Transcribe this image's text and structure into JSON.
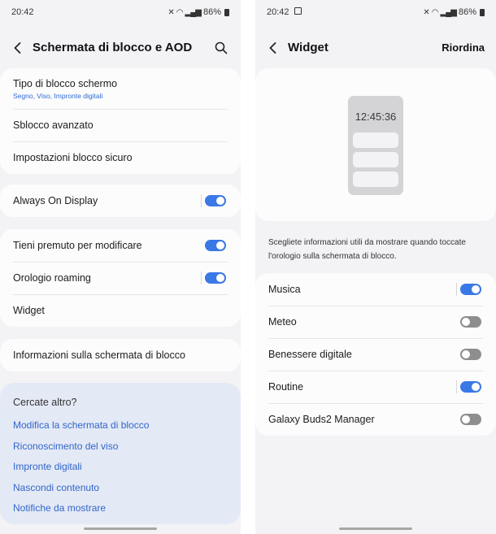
{
  "left": {
    "status": {
      "time": "20:42",
      "battery": "86%"
    },
    "header": {
      "title": "Schermata di blocco e AOD"
    },
    "group1": [
      {
        "label": "Tipo di blocco schermo",
        "sub": "Segno, Viso, Impronte digitali"
      },
      {
        "label": "Sblocco avanzato"
      },
      {
        "label": "Impostazioni blocco sicuro"
      }
    ],
    "aod": {
      "label": "Always On Display",
      "on": true
    },
    "group3": [
      {
        "label": "Tieni premuto per modificare",
        "on": true
      },
      {
        "label": "Orologio roaming",
        "on": true
      },
      {
        "label": "Widget"
      }
    ],
    "info": {
      "label": "Informazioni sulla schermata di blocco"
    },
    "suggest": {
      "head": "Cercate altro?",
      "links": [
        "Modifica la schermata di blocco",
        "Riconoscimento del viso",
        "Impronte digitali",
        "Nascondi contenuto",
        "Notifiche da mostrare"
      ]
    }
  },
  "right": {
    "status": {
      "time": "20:42",
      "battery": "86%"
    },
    "header": {
      "title": "Widget",
      "action": "Riordina"
    },
    "preview": {
      "clock": "12:45:36"
    },
    "description": "Scegliete informazioni utili da mostrare quando toccate l'orologio sulla schermata di blocco.",
    "widgets": [
      {
        "label": "Musica",
        "on": true
      },
      {
        "label": "Meteo",
        "on": false
      },
      {
        "label": "Benessere digitale",
        "on": false
      },
      {
        "label": "Routine",
        "on": true
      },
      {
        "label": "Galaxy Buds2 Manager",
        "on": false
      }
    ]
  },
  "colors": {
    "accent": "#3a78e6",
    "link": "#3066c8",
    "background": "#f3f3f6",
    "suggestBg": "#e4e9f6"
  }
}
